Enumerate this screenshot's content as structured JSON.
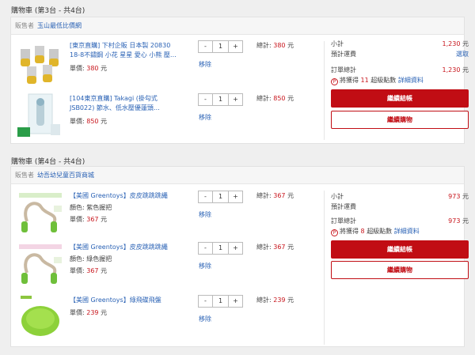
{
  "cart1": {
    "title": "購物車 (第3台 - 共4台)",
    "seller_label": "販售者",
    "seller_name": "玉山最低比價網",
    "items": [
      {
        "name": "[東京直購] 下村企販 日本製 20830 18-8不鏽鋼 小花 星星 愛心 小熊 壓…",
        "unit_label": "單價:",
        "unit_price": "380",
        "currency": "元",
        "qty": "1",
        "remove": "移除",
        "total_label": "總計:",
        "total": "380"
      },
      {
        "name": "[104東京直購] Takagi (掛勾式 JSB022) 節水、低水壓優蓮頭…",
        "unit_label": "單價:",
        "unit_price": "850",
        "currency": "元",
        "qty": "1",
        "remove": "移除",
        "total_label": "總計:",
        "total": "850"
      }
    ],
    "summary": {
      "subtotal_label": "小計",
      "subtotal": "1,230",
      "currency": "元",
      "shipping_label": "預計運費",
      "shipping_action": "選取",
      "order_total_label": "訂單總計",
      "order_total": "1,230",
      "points_badge": "P",
      "points_prefix": "將獲得",
      "points_value": "11",
      "points_suffix": "超級點數",
      "points_detail": "詳細資料",
      "checkout": "繼續結帳",
      "continue": "繼續購物"
    }
  },
  "cart2": {
    "title": "購物車 (第4台 - 共4台)",
    "seller_label": "販售者",
    "seller_name": "幼吾幼兒童百貨商城",
    "items": [
      {
        "name": "【美國 Greentoys】皮皮跳跳跳繩",
        "variant": "顏色: 紫色握把",
        "unit_label": "單價:",
        "unit_price": "367",
        "currency": "元",
        "qty": "1",
        "remove": "移除",
        "total_label": "總計:",
        "total": "367"
      },
      {
        "name": "【美國 Greentoys】皮皮跳跳跳繩",
        "variant": "顏色: 綠色握把",
        "unit_label": "單價:",
        "unit_price": "367",
        "currency": "元",
        "qty": "1",
        "remove": "移除",
        "total_label": "總計:",
        "total": "367"
      },
      {
        "name": "【美國 Greentoys】綠飛碟飛盤",
        "unit_label": "單價:",
        "unit_price": "239",
        "currency": "元",
        "qty": "1",
        "remove": "移除",
        "total_label": "總計:",
        "total": "239"
      }
    ],
    "summary": {
      "subtotal_label": "小計",
      "subtotal": "973",
      "currency": "元",
      "shipping_label": "預計運費",
      "order_total_label": "訂單總計",
      "order_total": "973",
      "points_badge": "P",
      "points_prefix": "將獲得",
      "points_value": "8",
      "points_suffix": "超級點數",
      "points_detail": "詳細資料",
      "checkout": "繼續結帳",
      "continue": "繼續購物"
    }
  },
  "qty_controls": {
    "minus": "-",
    "plus": "+"
  },
  "colors": {
    "accent_red": "#c10d14",
    "link_blue": "#2a62b5"
  }
}
